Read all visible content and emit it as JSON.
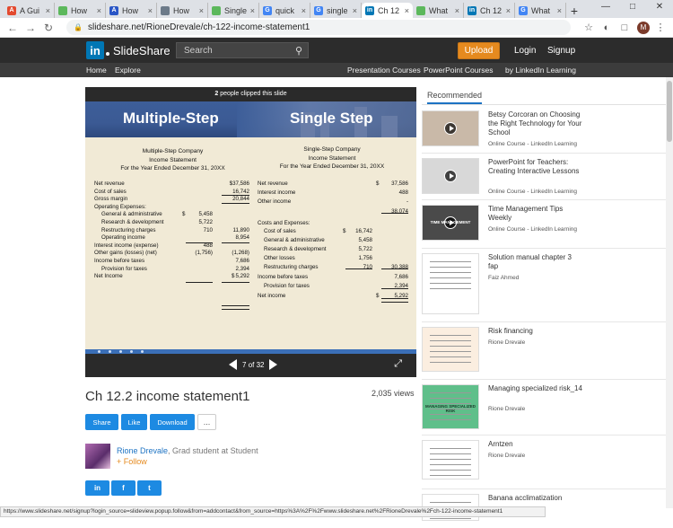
{
  "browser": {
    "tabs": [
      {
        "title": "A Gui",
        "color": "#e34a2f",
        "letter": "A"
      },
      {
        "title": "How",
        "color": "#5cb85c",
        "letter": ""
      },
      {
        "title": "How",
        "color": "#2a56c6",
        "letter": "A"
      },
      {
        "title": "How",
        "color": "#6c7a89",
        "letter": ""
      },
      {
        "title": "Single",
        "color": "#5cb85c",
        "letter": ""
      },
      {
        "title": "quick",
        "color": "#4285f4",
        "letter": "G"
      },
      {
        "title": "single",
        "color": "#4285f4",
        "letter": "G"
      },
      {
        "title": "Ch 12",
        "color": "#0077b5",
        "letter": "in"
      },
      {
        "title": "What",
        "color": "#5cb85c",
        "letter": ""
      },
      {
        "title": "Ch 12",
        "color": "#0077b5",
        "letter": "in"
      },
      {
        "title": "What",
        "color": "#4285f4",
        "letter": "G"
      }
    ],
    "url": "slideshare.net/RioneDrevale/ch-122-income-statement1",
    "profile_initial": "M",
    "status_url": "https://www.slideshare.net/signup?login_source=slideview.popup.follow&from=addcontact&from_source=https%3A%2F%2Fwww.slideshare.net%2FRioneDrevale%2Fch-122-income-statement1"
  },
  "header": {
    "logo_text": "SlideShare",
    "search_placeholder": "Search",
    "upload": "Upload",
    "login": "Login",
    "signup": "Signup"
  },
  "subnav": {
    "home": "Home",
    "explore": "Explore",
    "presentation_courses": "Presentation Courses",
    "powerpoint_courses": "PowerPoint Courses",
    "linkedin_learning": "by LinkedIn Learning"
  },
  "player": {
    "clipped_count": "2",
    "clipped_text": "people clipped this slide",
    "pager_current": "7",
    "pager_text": "of 32"
  },
  "slide": {
    "left_title": "Multiple-Step",
    "right_title": "Single Step",
    "left_heading": [
      "Multiple-Step Company",
      "Income Statement",
      "For the Year Ended December 31, 20XX"
    ],
    "right_heading": [
      "Single-Step Company",
      "Income Statement",
      "For the Year Ended December 31, 20XX"
    ],
    "left_rows": [
      {
        "label": "Net revenue",
        "a": "",
        "b": "$37,586"
      },
      {
        "label": "Cost of sales",
        "a": "",
        "b": "16,742"
      },
      {
        "label": "Gross margin",
        "a": "",
        "b": "20,844"
      },
      {
        "label": "Operating Expenses:",
        "a": "",
        "b": ""
      },
      {
        "label": "General & administrative",
        "pre": "$",
        "a": "5,458",
        "b": ""
      },
      {
        "label": "Research & development",
        "a": "5,722",
        "b": ""
      },
      {
        "label": "Restructuring charges",
        "a": "710",
        "b": "11,890"
      },
      {
        "label": "Operating income",
        "a": "",
        "b": "8,954"
      },
      {
        "label": "Interest income (expense)",
        "a": "488",
        "b": ""
      },
      {
        "label": "Other gains (losses) (net)",
        "a": "(1,756)",
        "b": "(1,268)"
      },
      {
        "label": "Income before taxes",
        "a": "",
        "b": "7,686"
      },
      {
        "label": "Provision for taxes",
        "a": "",
        "b": "2,394"
      },
      {
        "label": "Net Income",
        "pre": "$",
        "a": "",
        "b": "5,292"
      }
    ],
    "right_rows": [
      {
        "label": "Net revenue",
        "pre": "$",
        "a": "",
        "b": "37,586"
      },
      {
        "label": "Interest income",
        "a": "",
        "b": "488"
      },
      {
        "label": "Other income",
        "a": "",
        "b": "-"
      },
      {
        "label": "",
        "a": "",
        "b": "38,074"
      },
      {
        "label": "Costs and Expenses:",
        "a": "",
        "b": ""
      },
      {
        "label": "Cost of sales",
        "pre": "$",
        "a": "16,742",
        "b": ""
      },
      {
        "label": "General & administrative",
        "a": "5,458",
        "b": ""
      },
      {
        "label": "Research & development",
        "a": "5,722",
        "b": ""
      },
      {
        "label": "Other losses",
        "a": "1,756",
        "b": ""
      },
      {
        "label": "Restructuring charges",
        "a": "710",
        "b": "30,388"
      },
      {
        "label": "Income before taxes",
        "a": "",
        "b": "7,686"
      },
      {
        "label": "Provision for taxes",
        "a": "",
        "b": "2,394"
      },
      {
        "label": "Net income",
        "pre": "$",
        "a": "",
        "b": "5,292"
      }
    ]
  },
  "doc": {
    "title": "Ch 12.2 income statement1",
    "views": "2,035 views",
    "share": "Share",
    "like": "Like",
    "download": "Download",
    "more": "...",
    "author": "Rione Drevale",
    "author_role": ", Grad student at Student",
    "follow": "Follow"
  },
  "social": [
    "in",
    "f",
    "t"
  ],
  "recommended": {
    "label": "Recommended",
    "items": [
      {
        "title": "Betsy Corcoran on Choosing the Right Technology for Your School",
        "sub": "Online Course - LinkedIn Learning",
        "thumb": "#c9b9a8",
        "video": true
      },
      {
        "title": "PowerPoint for Teachers: Creating Interactive Lessons",
        "sub": "Online Course - LinkedIn Learning",
        "thumb": "#d8d8d8",
        "video": true
      },
      {
        "title": "Time Management Tips Weekly",
        "sub": "Online Course - LinkedIn Learning",
        "thumb": "#4a4a4a",
        "video": true,
        "overlay": "TIME MANAGEMENT"
      },
      {
        "title": "Solution manual chapter 3 fap",
        "sub": "Faiz Ahmed",
        "thumb": "#ffffff"
      },
      {
        "title": "Risk financing",
        "sub": "Rione Drevale",
        "thumb": "#fbeee0"
      },
      {
        "title": "Managing specialized risk_14",
        "sub": "Rione Drevale",
        "thumb": "#5fbf8a",
        "overlay": "MANAGING SPECIALIZED RISK"
      },
      {
        "title": "Arntzen",
        "sub": "Rione Drevale",
        "thumb": "#ffffff"
      },
      {
        "title": "Banana acclimatization",
        "sub": "",
        "thumb": "#ffffff"
      }
    ]
  }
}
